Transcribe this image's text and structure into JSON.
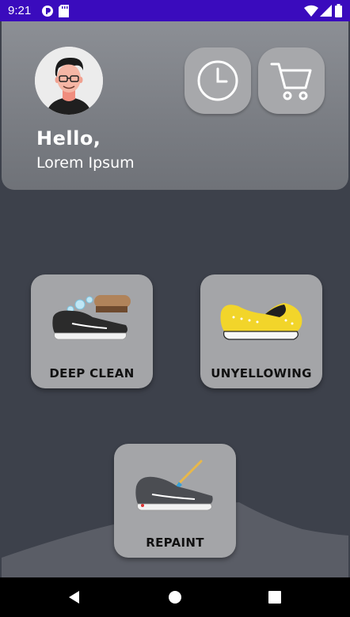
{
  "status_bar": {
    "time": "9:21"
  },
  "header": {
    "greeting": "Hello,",
    "username": "Lorem Ipsum"
  },
  "services": [
    {
      "label": "DEEP CLEAN"
    },
    {
      "label": "UNYELLOWING"
    },
    {
      "label": "REPAINT"
    }
  ],
  "colors": {
    "status_bar": "#3a0bbd",
    "background": "#3d414b",
    "header": "#7a7d83",
    "card": "#a4a5a8",
    "nav_bar": "#000000"
  }
}
